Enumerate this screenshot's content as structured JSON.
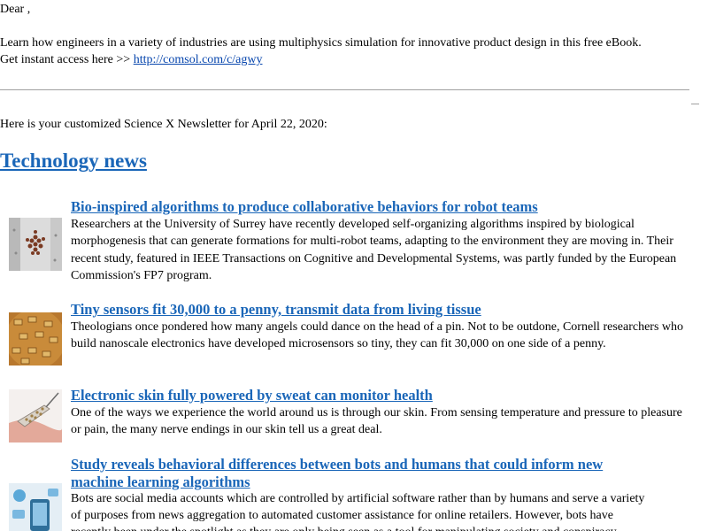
{
  "greeting": "Dear ,",
  "promo": {
    "text": "Learn how engineers in a variety of industries are using multiphysics simulation for innovative product design in this free eBook.",
    "access_prefix": "Get instant access here >> ",
    "link_text": "http://comsol.com/c/agwy"
  },
  "intro": "Here is your customized Science X Newsletter for April 22, 2020:",
  "section_title": "Technology news",
  "articles": [
    {
      "title": "Bio-inspired algorithms to produce collaborative behaviors for robot teams",
      "body": "Researchers at the University of Surrey have recently developed self-organizing algorithms inspired by biological morphogenesis that can generate formations for multi-robot teams, adapting to the environment they are moving in. Their recent study, featured in IEEE Transactions on Cognitive and Developmental Systems, was partly funded by the European Commission's FP7 program.",
      "thumbnail": "robot-swarm-image"
    },
    {
      "title": "Tiny sensors fit 30,000 to a penny, transmit data from living tissue",
      "body": "Theologians once pondered how many angels could dance on the head of a pin. Not to be outdone, Cornell researchers who build nanoscale electronics have developed microsensors so tiny, they can fit 30,000 on one side of a penny.",
      "thumbnail": "microsensors-on-penny-image"
    },
    {
      "title": "Electronic skin fully powered by sweat can monitor health",
      "body": "One of the ways we experience the world around us is through our skin. From sensing temperature and pressure to pleasure or pain, the many nerve endings in our skin tell us a great deal.",
      "thumbnail": "electronic-skin-image"
    },
    {
      "title_line1": "Study reveals behavioral differences between bots and humans that could inform new",
      "title_line2": "machine learning algorithms",
      "body_line1": "Bots are social media accounts which are controlled by artificial software rather than by humans and serve a variety",
      "body_line2": "of purposes from news aggregation to automated customer assistance for online retailers. However, bots have",
      "body_line3": "recently been under the spotlight as they are only being seen as a tool for manipulating society and conspiracy",
      "thumbnail": "social-media-bots-image"
    }
  ]
}
